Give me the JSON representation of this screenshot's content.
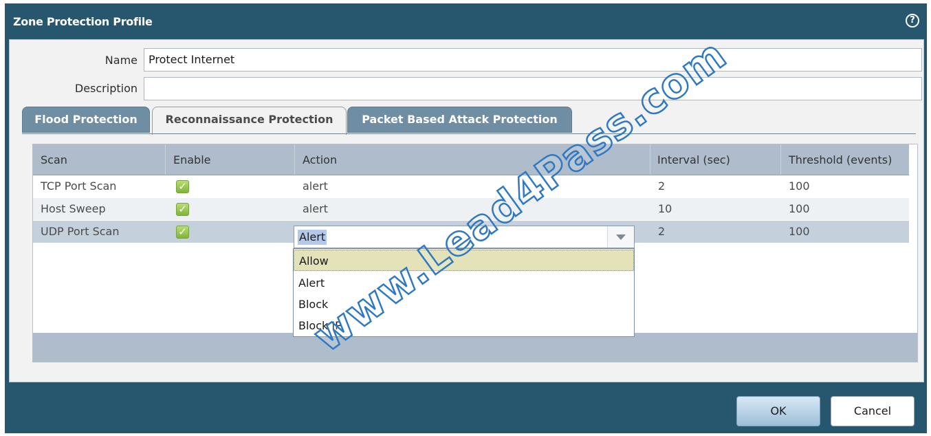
{
  "dialog": {
    "title": "Zone Protection Profile",
    "help_icon": "?"
  },
  "form": {
    "name_label": "Name",
    "name_value": "Protect Internet",
    "description_label": "Description",
    "description_value": ""
  },
  "tabs": [
    {
      "label": "Flood Protection",
      "active": false
    },
    {
      "label": "Reconnaissance Protection",
      "active": true
    },
    {
      "label": "Packet Based Attack Protection",
      "active": false
    }
  ],
  "table": {
    "columns": [
      "Scan",
      "Enable",
      "Action",
      "Interval (sec)",
      "Threshold (events)"
    ],
    "rows": [
      {
        "scan": "TCP Port Scan",
        "enable": true,
        "action": "alert",
        "interval": "2",
        "threshold": "100"
      },
      {
        "scan": "Host Sweep",
        "enable": true,
        "action": "alert",
        "interval": "10",
        "threshold": "100"
      },
      {
        "scan": "UDP Port Scan",
        "enable": true,
        "action": "Alert",
        "interval": "2",
        "threshold": "100"
      }
    ]
  },
  "action_combo": {
    "value": "Alert",
    "options": [
      "Allow",
      "Alert",
      "Block",
      "Block IP"
    ],
    "highlighted": "Allow"
  },
  "buttons": {
    "ok": "OK",
    "cancel": "Cancel"
  },
  "watermark": "www.Lead4Pass.com",
  "colors": {
    "titlebar": "#27566f",
    "header": "#aebccb",
    "selected_row": "#c4d1dd",
    "highlight_option": "#e3e2b9",
    "checkbox": "#8cc04a",
    "watermark": "#2f79c2"
  }
}
